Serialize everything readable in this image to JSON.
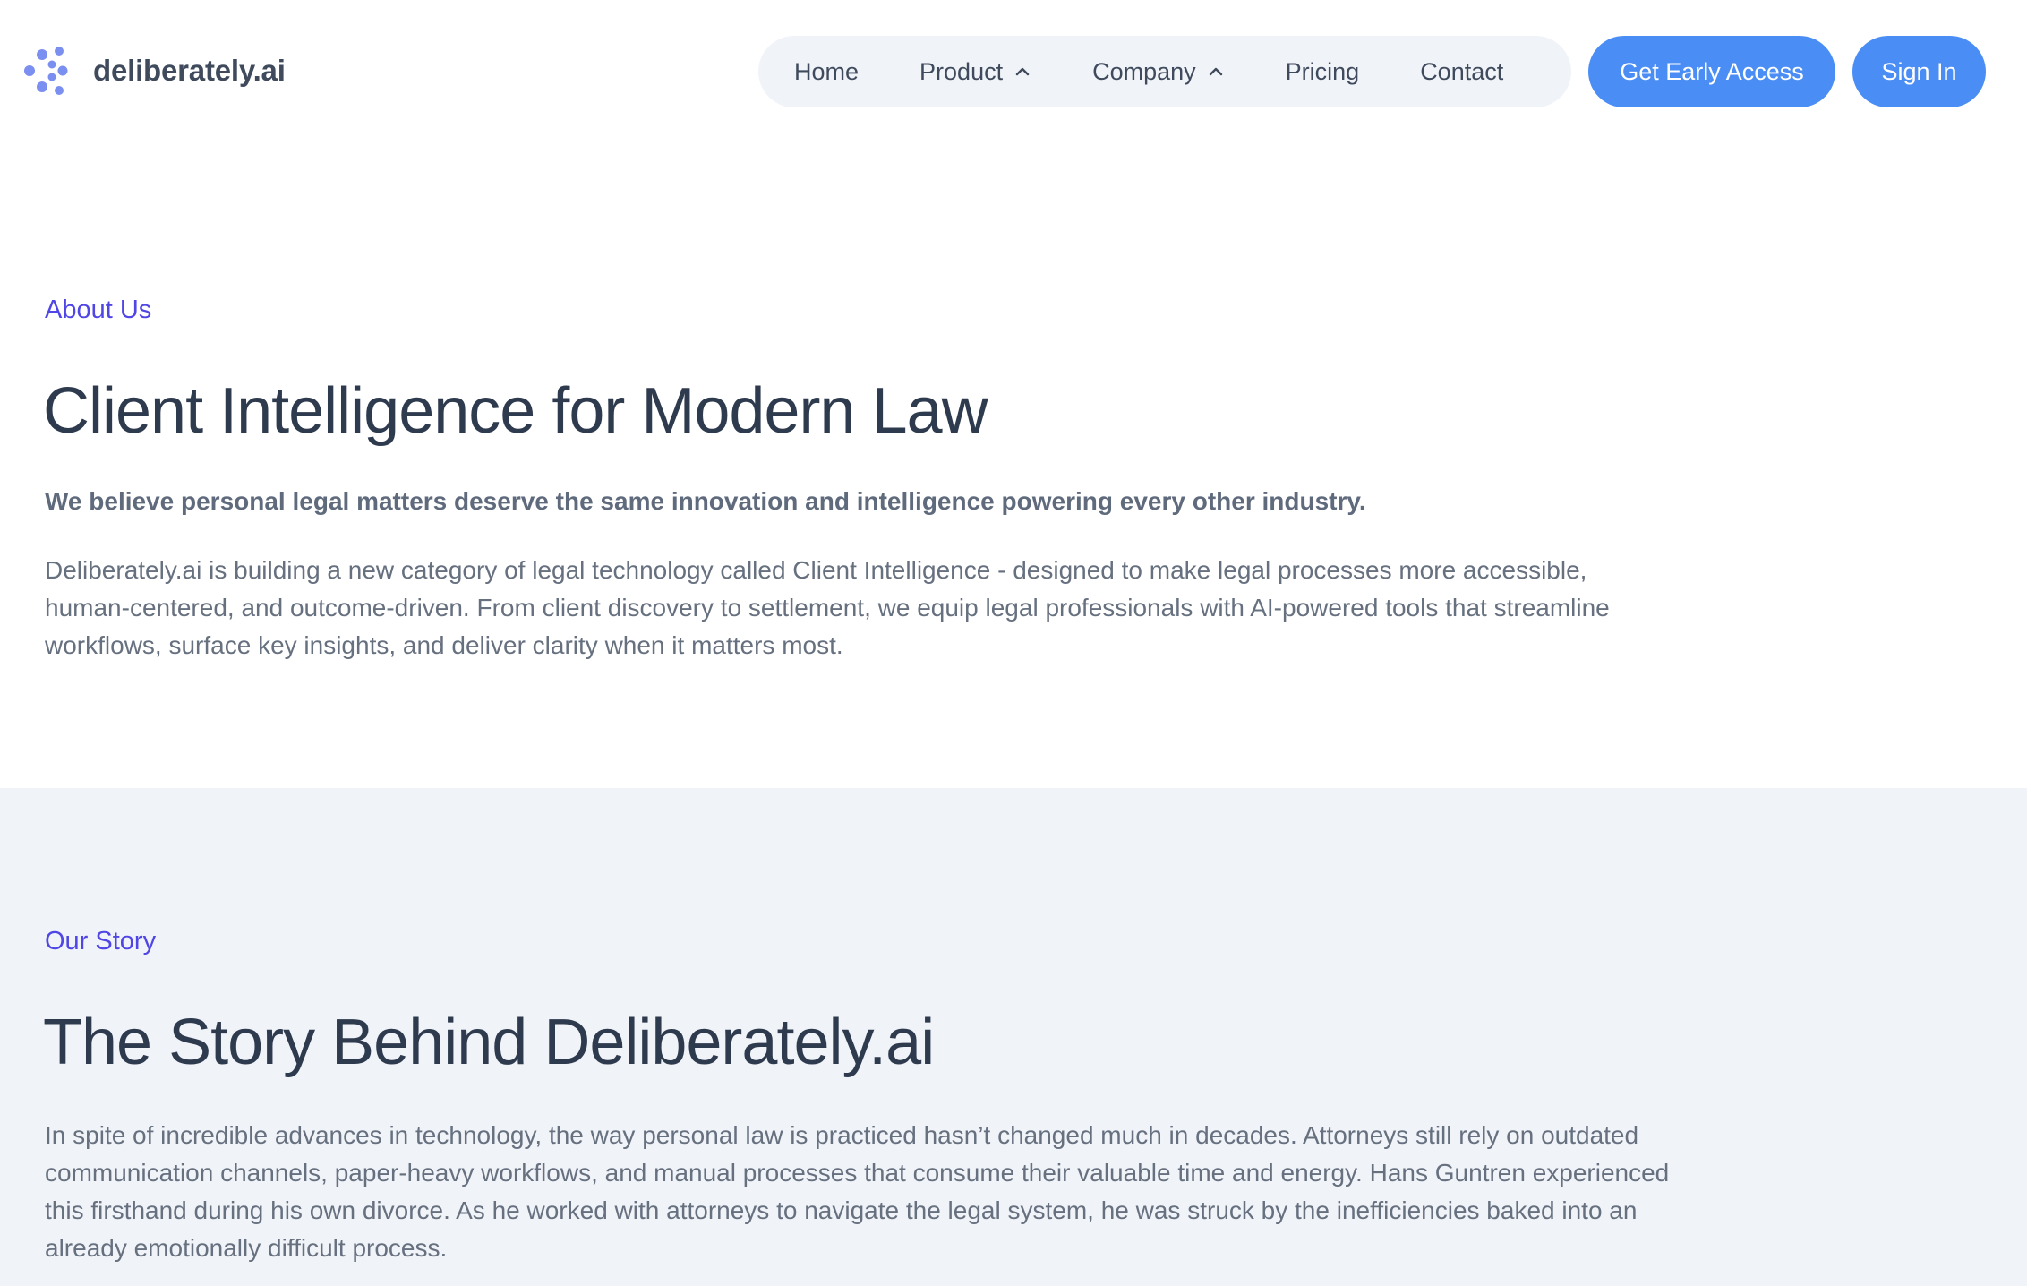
{
  "header": {
    "brand": "deliberately.ai",
    "nav": {
      "home": "Home",
      "product": "Product",
      "company": "Company",
      "pricing": "Pricing",
      "contact": "Contact"
    },
    "cta_early_access": "Get Early Access",
    "cta_sign_in": "Sign In"
  },
  "about": {
    "eyebrow": "About Us",
    "title": "Client Intelligence for Modern Law",
    "lead": "We believe personal legal matters deserve the same innovation and intelligence powering every other industry.",
    "body": "Deliberately.ai is building a new category of legal technology called Client Intelligence - designed to make legal processes more accessible, human-centered, and outcome-driven. From client discovery to settlement, we equip legal professionals with AI-powered tools that streamline workflows, surface key insights, and deliver clarity when it matters most."
  },
  "story": {
    "eyebrow": "Our Story",
    "title": "The Story Behind Deliberately.ai",
    "body": "In spite of incredible advances in technology, the way personal law is practiced hasn’t changed much in decades. Attorneys still rely on outdated communication channels, paper-heavy workflows, and manual processes that consume their valuable time and energy. Hans Guntren experienced this firsthand during his own divorce. As he worked with attorneys to navigate the legal system, he was struck by the inefficiencies baked into an already emotionally difficult process."
  },
  "colors": {
    "accent": "#4a8ef5",
    "eyebrow": "#4f46e5",
    "logo": "#7b8ff0",
    "heading": "#2e3a4d",
    "body": "#66707f",
    "section_bg": "#f0f3f8"
  },
  "icons": {
    "logo": "brand-dots-icon",
    "product_caret": "chevron-up-icon",
    "company_caret": "chevron-up-icon"
  }
}
